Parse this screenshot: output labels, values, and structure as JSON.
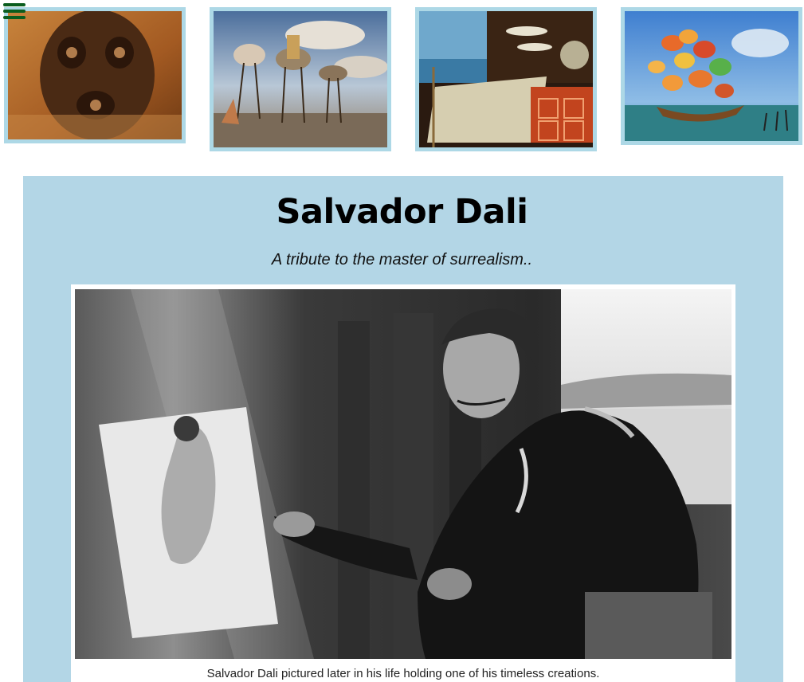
{
  "nav": {
    "menu_icon": "hamburger-menu-icon",
    "menu_color": "#0b5d1e"
  },
  "gallery": {
    "images": [
      {
        "name": "painting-face-of-war",
        "alt": "Salvador Dali painting 1"
      },
      {
        "name": "painting-temptation-of-st-anthony",
        "alt": "Salvador Dali painting 2"
      },
      {
        "name": "painting-still-life",
        "alt": "Salvador Dali painting 3"
      },
      {
        "name": "painting-butterfly-ship",
        "alt": "Salvador Dali painting 4"
      }
    ],
    "frame_color": "#add8e6"
  },
  "tribute": {
    "title": "Salvador Dali",
    "subtitle": "A tribute to the master of surrealism..",
    "image_alt": "Salvador Dali portrait",
    "caption": "Salvador Dali pictured later in his life holding one of his timeless creations.",
    "background_color": "#b3d6e6"
  }
}
